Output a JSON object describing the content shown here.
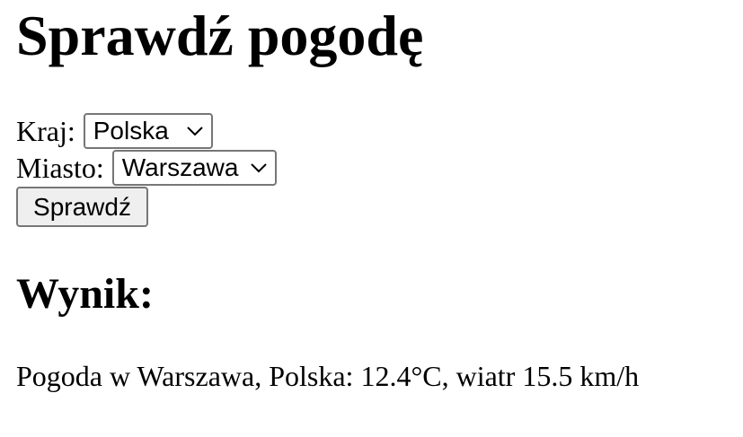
{
  "page": {
    "title": "Sprawdź pogodę"
  },
  "form": {
    "country_label": "Kraj:",
    "country_value": "Polska",
    "city_label": "Miasto:",
    "city_value": "Warszawa",
    "submit_label": "Sprawdź",
    "select_icon": "chevron-down-icon"
  },
  "result": {
    "heading": "Wynik:",
    "text": "Pogoda w Warszawa, Polska: 12.4°C, wiatr 15.5 km/h"
  }
}
